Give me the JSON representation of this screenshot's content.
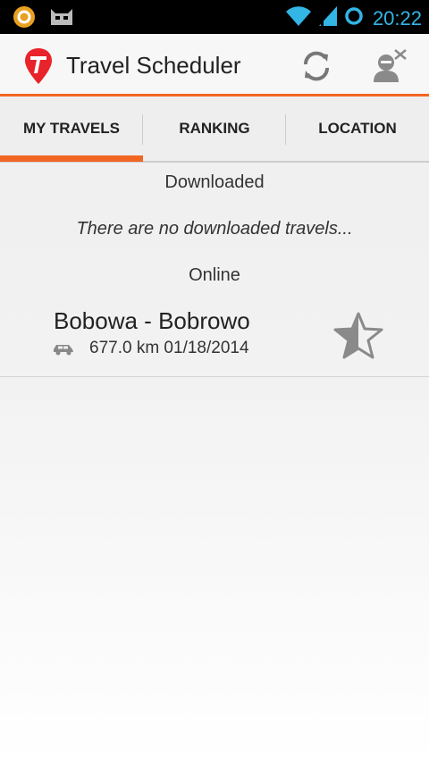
{
  "status_bar": {
    "time": "20:22",
    "icons": [
      "app-notification-icon",
      "cyanogen-notification-icon",
      "wifi-icon",
      "signal-icon",
      "sync-ring-icon"
    ],
    "accent_color": "#33b5e5"
  },
  "app": {
    "title": "Travel Scheduler",
    "brand_color": "#f26522",
    "actions": [
      "refresh-icon",
      "account-off-icon"
    ]
  },
  "tabs": [
    {
      "label": "MY TRAVELS",
      "active": true
    },
    {
      "label": "RANKING",
      "active": false
    },
    {
      "label": "LOCATION",
      "active": false
    }
  ],
  "content": {
    "downloaded_title": "Downloaded",
    "downloaded_empty": "There are no downloaded travels...",
    "online_title": "Online",
    "travels": [
      {
        "name": "Bobowa - Bobrowo",
        "distance": "677.0 km",
        "date": "01/18/2014",
        "details": "677.0 km 01/18/2014",
        "vehicle_icon": "car-icon",
        "rating_icon": "star-half-icon"
      }
    ]
  }
}
